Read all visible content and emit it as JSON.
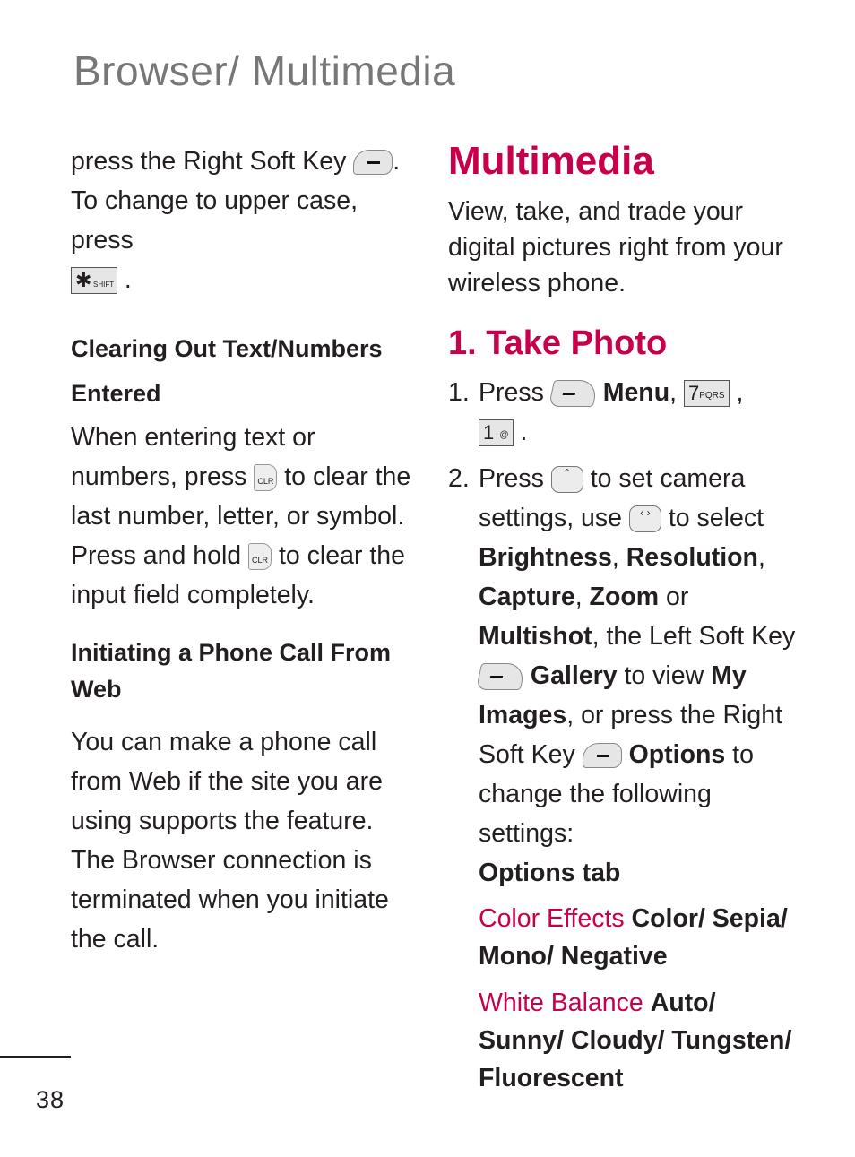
{
  "header": {
    "section_title": "Browser/ Multimedia"
  },
  "left_column": {
    "intro": {
      "line1_before": "press the Right Soft Key",
      "line1_after": ".",
      "line2": "To change to upper case, press",
      "shift_key": {
        "main": "✱",
        "label": "SHIFT"
      },
      "line3_after": "."
    },
    "clearing": {
      "heading": "Clearing Out Text/Numbers Entered",
      "text_1": "When entering text or numbers, press",
      "text_2": "to clear the last number, letter, or symbol. Press and hold",
      "text_3": "to clear the input field completely.",
      "clr_label": "CLR"
    },
    "initiating": {
      "heading": "Initiating a Phone Call From Web",
      "text_1": "You can make a phone call from Web if the site you are using supports the feature.",
      "text_2": "The Browser connection is terminated when you initiate the call."
    }
  },
  "right_column": {
    "title": "Multimedia",
    "intro": "View, take, and trade your digital pictures right from your wireless phone.",
    "section": {
      "title": "1. Take Photo",
      "step1": {
        "num": "1.",
        "press": "Press",
        "menu": "Menu",
        "comma": ",",
        "key7": {
          "digit": "7",
          "letters": "PQRS"
        },
        "key1": {
          "digit": "1",
          "symbol": "@"
        },
        "end": "."
      },
      "step2": {
        "num": "2.",
        "press": "Press",
        "t1": "to set camera settings, use",
        "t2": "to select",
        "brightness": "Brightness",
        "resolution": "Resolution",
        "capture": "Capture",
        "zoom": "Zoom",
        "or": "or",
        "multishot": "Multishot",
        "t3": ", the Left Soft Key",
        "gallery": "Gallery",
        "t4": "to view",
        "my_images": "My Images",
        "t5": ", or press the Right Soft Key",
        "options": "Options",
        "t6": "to change the following settings:",
        "options_tab": "Options tab"
      },
      "settings": [
        {
          "name": "Color Effects",
          "values": "Color/ Sepia/ Mono/ Negative"
        },
        {
          "name": "White Balance",
          "values": "Auto/ Sunny/ Cloudy/ Tungsten/ Fluorescent"
        }
      ]
    }
  },
  "footer": {
    "page_number": "38"
  },
  "colors": {
    "accent": "#c8004b",
    "header_gray": "#777777",
    "text": "#231f20"
  }
}
